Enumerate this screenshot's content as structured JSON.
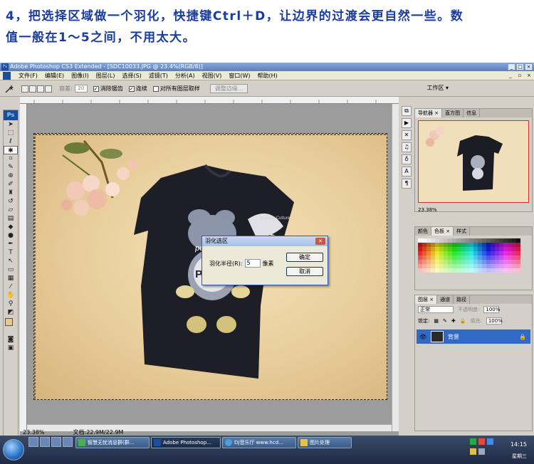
{
  "caption": {
    "line1": "4，把选择区域做一个羽化，快捷键Ctrl＋D，让边界的过渡会更自然一些。数",
    "line2": "值一般在1～5之间，不用太大。"
  },
  "window": {
    "title": "Adobe Photoshop CS3 Extended - [SDC10033.JPG @ 23.4%(RGB/8)]",
    "app_icon": "Ps"
  },
  "menu": [
    "文件(F)",
    "编辑(E)",
    "图像(I)",
    "图层(L)",
    "选择(S)",
    "滤镜(T)",
    "分析(A)",
    "视图(V)",
    "窗口(W)",
    "帮助(H)"
  ],
  "options": {
    "feather_label": "容差:",
    "feather_value": "20",
    "antialias": "消除锯齿",
    "contiguous": "连续",
    "all_layers": "对所有图层取样",
    "refine_edge": "调整边缘...",
    "workspace": "工作区 ▾"
  },
  "toolbox_logo": "Ps",
  "document": {
    "zoom": "23.38%",
    "doc_size": "文档:22.9M/22.9M"
  },
  "dialog": {
    "title": "羽化选区",
    "radius_label": "羽化半径(R):",
    "radius_value": "5",
    "unit": "像素",
    "ok": "确定",
    "cancel": "取消",
    "close": "✕"
  },
  "panels": {
    "nav_tabs": [
      "导航器 ×",
      "直方图",
      "信息"
    ],
    "nav_zoom": "23.38%",
    "color_tabs": [
      "颜色",
      "色板 ×",
      "样式"
    ],
    "layer_tabs": [
      "图层 ×",
      "通道",
      "路径"
    ],
    "blend_mode": "正常",
    "opacity_label": "不透明度:",
    "opacity_value": "100%",
    "lock_label": "锁定:",
    "fill_label": "填充:",
    "fill_value": "100%",
    "layer_name": "背景"
  },
  "taskbar": {
    "items": [
      "智慧无忧消息群(群...",
      "Adobe Photoshop...",
      "DJ音乐厅 www.hcd...",
      "图片处理"
    ],
    "time": "14:15",
    "day": "星期三"
  },
  "tshirt_text": {
    "popularity": "popularity",
    "brand": "POPPY",
    "small": "popular Culture"
  }
}
